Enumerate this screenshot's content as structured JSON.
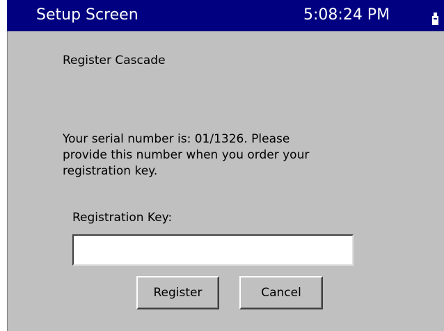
{
  "titlebar": {
    "title": "Setup Screen",
    "clock": "5:08:24 PM",
    "icon": "battery-icon",
    "color": "#000080"
  },
  "content": {
    "heading": "Register Cascade",
    "message": "Your serial number is: 01/1326.  Please\nprovide this number when you order your\nregistration key.",
    "key_label": "Registration Key:",
    "key_value": ""
  },
  "buttons": {
    "register": "Register",
    "cancel": "Cancel"
  },
  "colors": {
    "background": "#c0c0c0",
    "titlebar": "#000080"
  }
}
